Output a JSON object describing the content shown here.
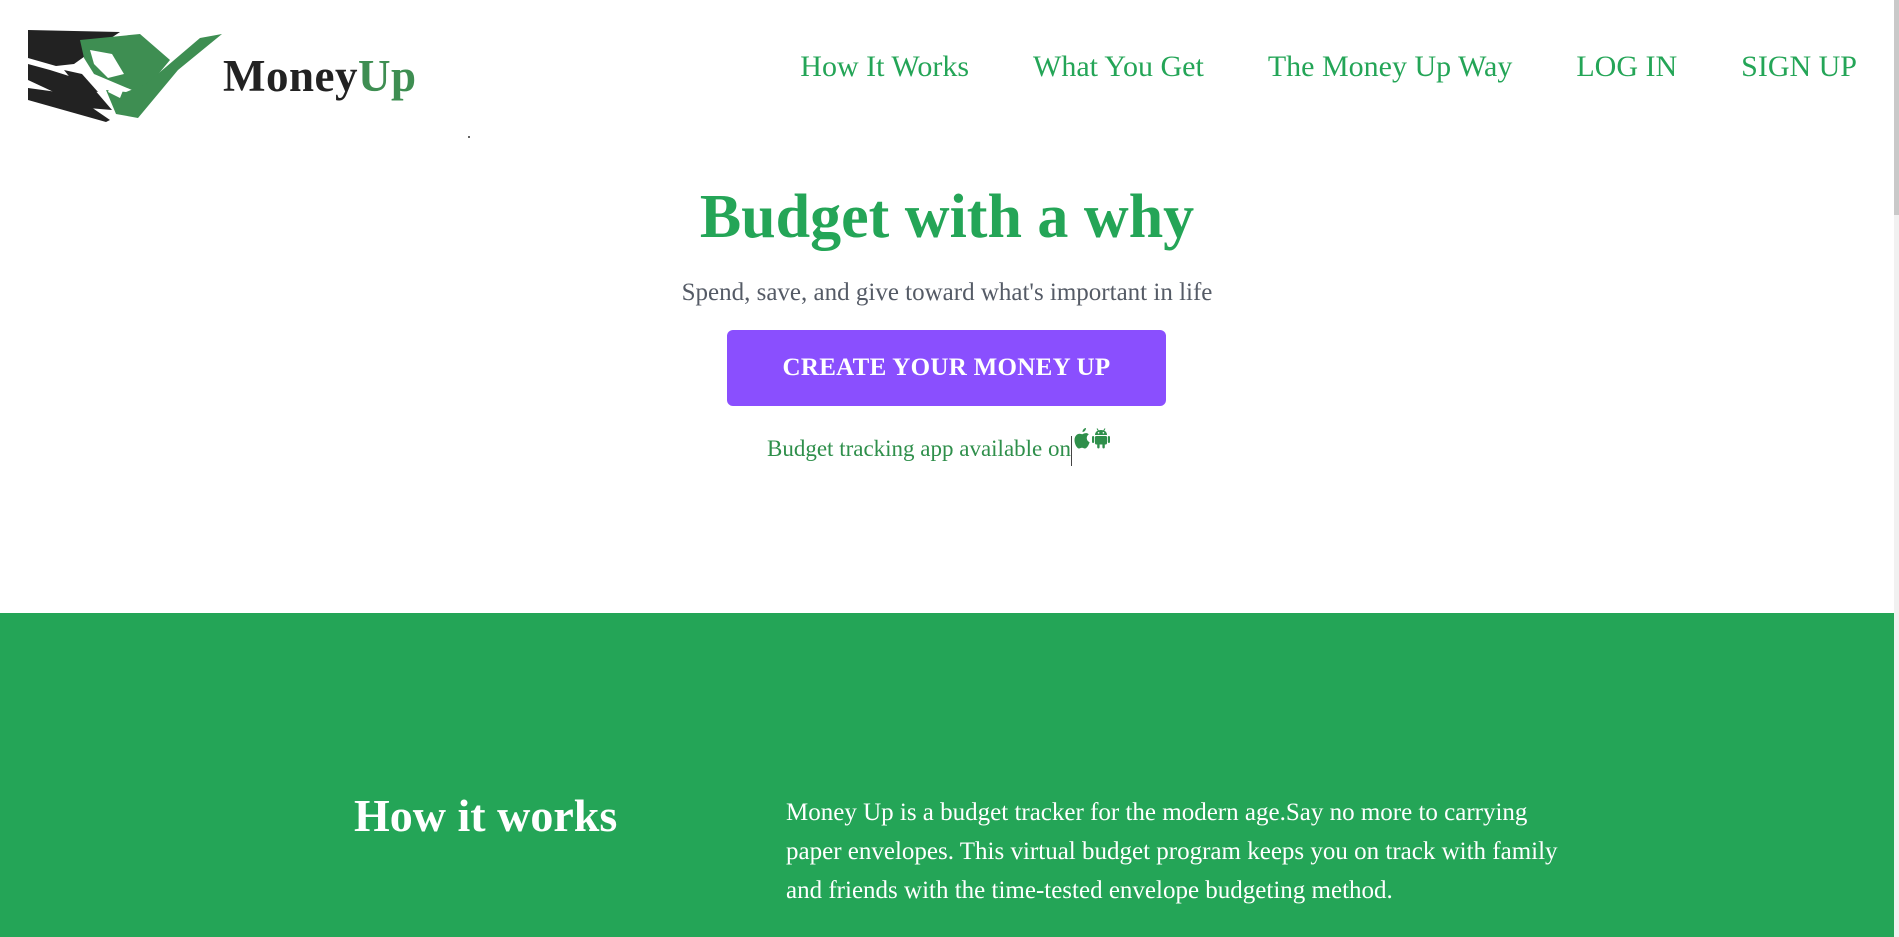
{
  "brand": {
    "name_part1": "Money",
    "name_part2": "Up",
    "colors": {
      "primary_green": "#24a557",
      "logo_green": "#3e8e52",
      "logo_dark": "#222222",
      "cta_purple": "#8a4ffe"
    }
  },
  "nav": {
    "items": [
      {
        "label": "How It Works"
      },
      {
        "label": "What You Get"
      },
      {
        "label": "The Money Up Way"
      },
      {
        "label": "LOG IN"
      },
      {
        "label": "SIGN UP"
      }
    ]
  },
  "hero": {
    "title": "Budget with a why",
    "subtitle": "Spend, save, and give toward what's important in life",
    "cta_label": "CREATE YOUR MONEY UP",
    "availability_text": "Budget tracking app available on",
    "store_icons": [
      "apple-icon",
      "android-icon"
    ]
  },
  "how_it_works": {
    "title": "How it works",
    "body": "Money Up is a budget tracker for the modern age.Say no more to carrying paper envelopes. This virtual budget program keeps you on track with family and friends with the time-tested envelope budgeting method."
  }
}
